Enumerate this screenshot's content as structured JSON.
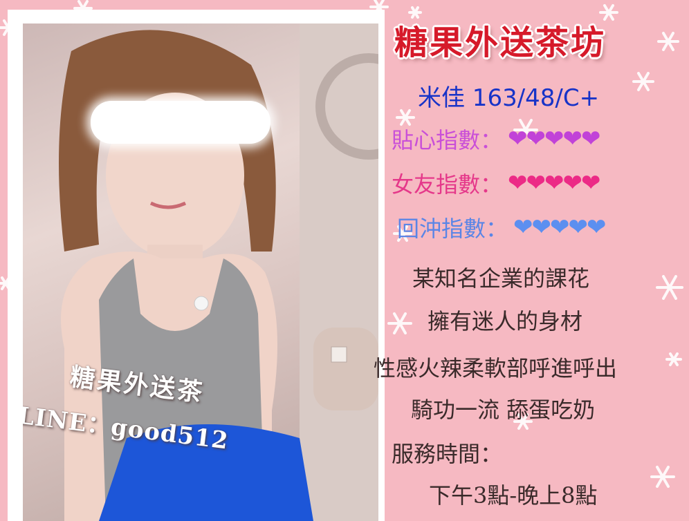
{
  "ad": {
    "title": "糖果外送茶坊",
    "stats": "米佳 163/48/C+",
    "ratings": [
      {
        "label": "貼心指數：",
        "hearts": "❤❤❤❤❤",
        "color": "#c142d8"
      },
      {
        "label": "女友指數：",
        "hearts": "❤❤❤❤❤",
        "color": "#ec2a86"
      },
      {
        "label": "回沖指數：",
        "hearts": "❤❤❤❤❤",
        "color": "#5c8ff0"
      }
    ],
    "description": [
      "某知名企業的課花",
      "擁有迷人的身材",
      "性感火辣柔軟部呼進呼出",
      "騎功一流  舔蛋吃奶",
      "服務時間：",
      "下午3點-晚上8點"
    ]
  },
  "photo": {
    "watermark_name": "糖果外送茶",
    "watermark_contact": "LINE：good512"
  },
  "colors": {
    "background": "#f6b9c2",
    "title": "#d61a2a",
    "stats": "#1733c8",
    "description": "#3a2a2a"
  }
}
